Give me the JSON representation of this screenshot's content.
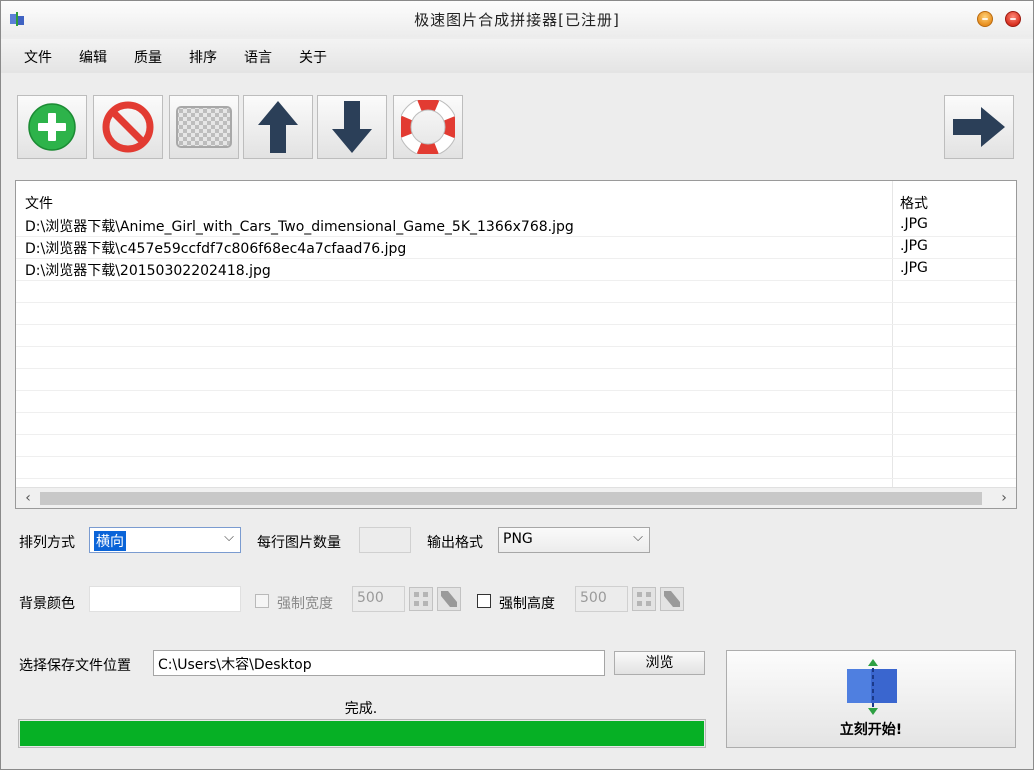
{
  "window": {
    "title": "极速图片合成拼接器[已注册]"
  },
  "menu": [
    "文件",
    "编辑",
    "质量",
    "排序",
    "语言",
    "关于"
  ],
  "toolbar": {
    "buttons": [
      {
        "name": "add-button",
        "icon": "plus-circle-icon",
        "color": "#2db34a"
      },
      {
        "name": "remove-button",
        "icon": "no-entry-icon",
        "color": "#e23b32"
      },
      {
        "name": "clear-button",
        "icon": "checkerboard-icon",
        "color": "#c8c8c8"
      },
      {
        "name": "move-up-button",
        "icon": "arrow-up-icon",
        "color": "#2b3f58"
      },
      {
        "name": "move-down-button",
        "icon": "arrow-down-icon",
        "color": "#2b3f58"
      },
      {
        "name": "help-button",
        "icon": "lifebuoy-icon",
        "color": "#e23b32"
      }
    ],
    "next": {
      "name": "next-button",
      "icon": "arrow-right-icon",
      "color": "#2b3f58"
    }
  },
  "file_list": {
    "columns": [
      "文件",
      "格式"
    ],
    "rows": [
      {
        "file": "D:\\浏览器下载\\Anime_Girl_with_Cars_Two_dimensional_Game_5K_1366x768.jpg",
        "format": ".JPG"
      },
      {
        "file": "D:\\浏览器下载\\c457e59ccfdf7c806f68ec4a7cfaad76.jpg",
        "format": ".JPG"
      },
      {
        "file": "D:\\浏览器下载\\20150302202418.jpg",
        "format": ".JPG"
      }
    ]
  },
  "options": {
    "arrange_label": "排列方式",
    "arrange_value": "横向",
    "per_row_label": "每行图片数量",
    "per_row_value": "",
    "output_format_label": "输出格式",
    "output_format_value": "PNG",
    "bg_color_label": "背景颜色",
    "bg_color_value": "",
    "force_width_label": "强制宽度",
    "force_width_value": "500",
    "force_height_label": "强制高度",
    "force_height_value": "500"
  },
  "save": {
    "label": "选择保存文件位置",
    "path": "C:\\Users\\木容\\Desktop",
    "browse_label": "浏览"
  },
  "status": {
    "text": "完成.",
    "progress": 1.0,
    "progress_color": "#06b025"
  },
  "start": {
    "label": "立刻开始!"
  }
}
